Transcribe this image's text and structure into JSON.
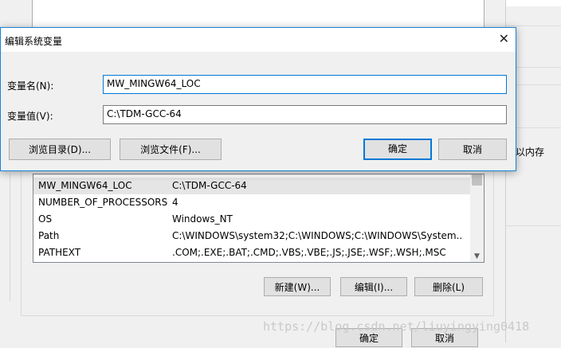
{
  "dialog": {
    "title": "编辑系统变量",
    "close_symbol": "✕",
    "name_label": "变量名(N):",
    "name_value": "MW_MINGW64_LOC",
    "value_label": "变量值(V):",
    "value_value": "C:\\TDM-GCC-64",
    "browse_dir_label": "浏览目录(D)...",
    "browse_file_label": "浏览文件(F)...",
    "ok_label": "确定",
    "cancel_label": "取消"
  },
  "system_variables": {
    "rows": [
      {
        "name": "MW_MINGW64_LOC",
        "value": "C:\\TDM-GCC-64",
        "selected": true
      },
      {
        "name": "NUMBER_OF_PROCESSORS",
        "value": "4"
      },
      {
        "name": "OS",
        "value": "Windows_NT"
      },
      {
        "name": "Path",
        "value": "C:\\WINDOWS\\system32;C:\\WINDOWS;C:\\WINDOWS\\System..."
      },
      {
        "name": "PATHEXT",
        "value": ".COM;.EXE;.BAT;.CMD;.VBS;.VBE;.JS;.JSE;.WSF;.WSH;.MSC"
      }
    ],
    "new_label": "新建(W)...",
    "edit_label": "编辑(I)...",
    "delete_label": "删除(L)"
  },
  "env_window": {
    "ok_label": "确定",
    "cancel_label": "取消"
  },
  "right_panel": {
    "partial_text": "以内存"
  },
  "watermark": "https://blog.csdn.net/liuyingying0418",
  "colors": {
    "accent": "#0078d7",
    "selected_row": "#e5e5e5"
  }
}
